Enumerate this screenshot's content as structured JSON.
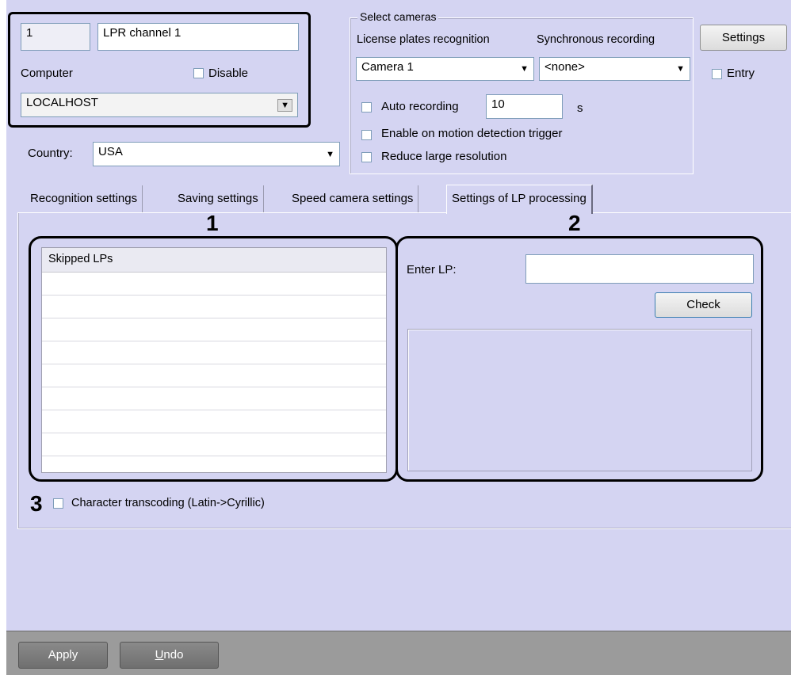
{
  "channel": {
    "number": "1",
    "name": "LPR channel 1"
  },
  "computer": {
    "label": "Computer",
    "disable_label": "Disable",
    "value": "LOCALHOST"
  },
  "country": {
    "label": "Country:",
    "value": "USA"
  },
  "select_cameras": {
    "title": "Select cameras",
    "lpr_label": "License plates recognition",
    "sync_label": "Synchronous recording",
    "lpr_camera": "Camera 1",
    "sync_camera": "<none>",
    "auto_recording_label": "Auto recording",
    "auto_recording_value": "10",
    "auto_recording_unit": "s",
    "motion_trigger_label": "Enable on motion detection trigger",
    "reduce_resolution_label": "Reduce large resolution"
  },
  "settings_button": "Settings",
  "entry_label": "Entry",
  "tabs": [
    {
      "label": "Recognition settings"
    },
    {
      "label": "Saving settings"
    },
    {
      "label": "Speed camera settings"
    },
    {
      "label": "Settings of LP processing",
      "active": true
    }
  ],
  "annotations": {
    "one": "1",
    "two": "2",
    "three": "3"
  },
  "skipped_list": {
    "header": "Skipped LPs",
    "rows": [
      "",
      "",
      "",
      "",
      "",
      "",
      "",
      ""
    ]
  },
  "check_lp": {
    "label": "Enter LP:",
    "value": "",
    "check_button": "Check"
  },
  "transcoding_label": "Character transcoding (Latin->Cyrillic)",
  "footer": {
    "apply": "Apply",
    "undo_prefix": "",
    "undo_mnemonic": "U",
    "undo_rest": "ndo"
  },
  "colors": {
    "panel": "#d4d4f2",
    "footer": "#9b9b9b",
    "annotation": "#000000"
  }
}
